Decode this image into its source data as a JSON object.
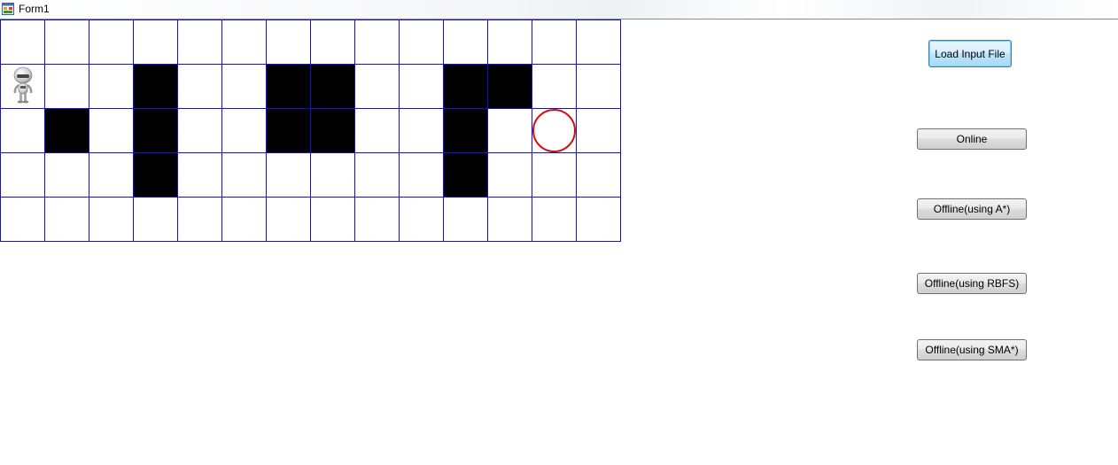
{
  "window": {
    "title": "Form1",
    "icon": "winforms-app-icon"
  },
  "grid": {
    "rows": 5,
    "cols": 14,
    "walls": [
      [
        1,
        3
      ],
      [
        1,
        6
      ],
      [
        1,
        7
      ],
      [
        1,
        10
      ],
      [
        1,
        11
      ],
      [
        2,
        1
      ],
      [
        2,
        3
      ],
      [
        2,
        6
      ],
      [
        2,
        7
      ],
      [
        2,
        10
      ],
      [
        3,
        3
      ],
      [
        3,
        10
      ]
    ],
    "agent": {
      "row": 1,
      "col": 0,
      "icon": "robot-icon"
    },
    "goal": {
      "row": 2,
      "col": 12,
      "color": "#d01010"
    },
    "line_color": "#1a1a8c"
  },
  "buttons": {
    "load_input_file": "Load Input File",
    "online": "Online",
    "offline_astar": "Offline(using A*)",
    "offline_rbfs": "Offline(using RBFS)",
    "offline_sma": "Offline(using SMA*)"
  }
}
